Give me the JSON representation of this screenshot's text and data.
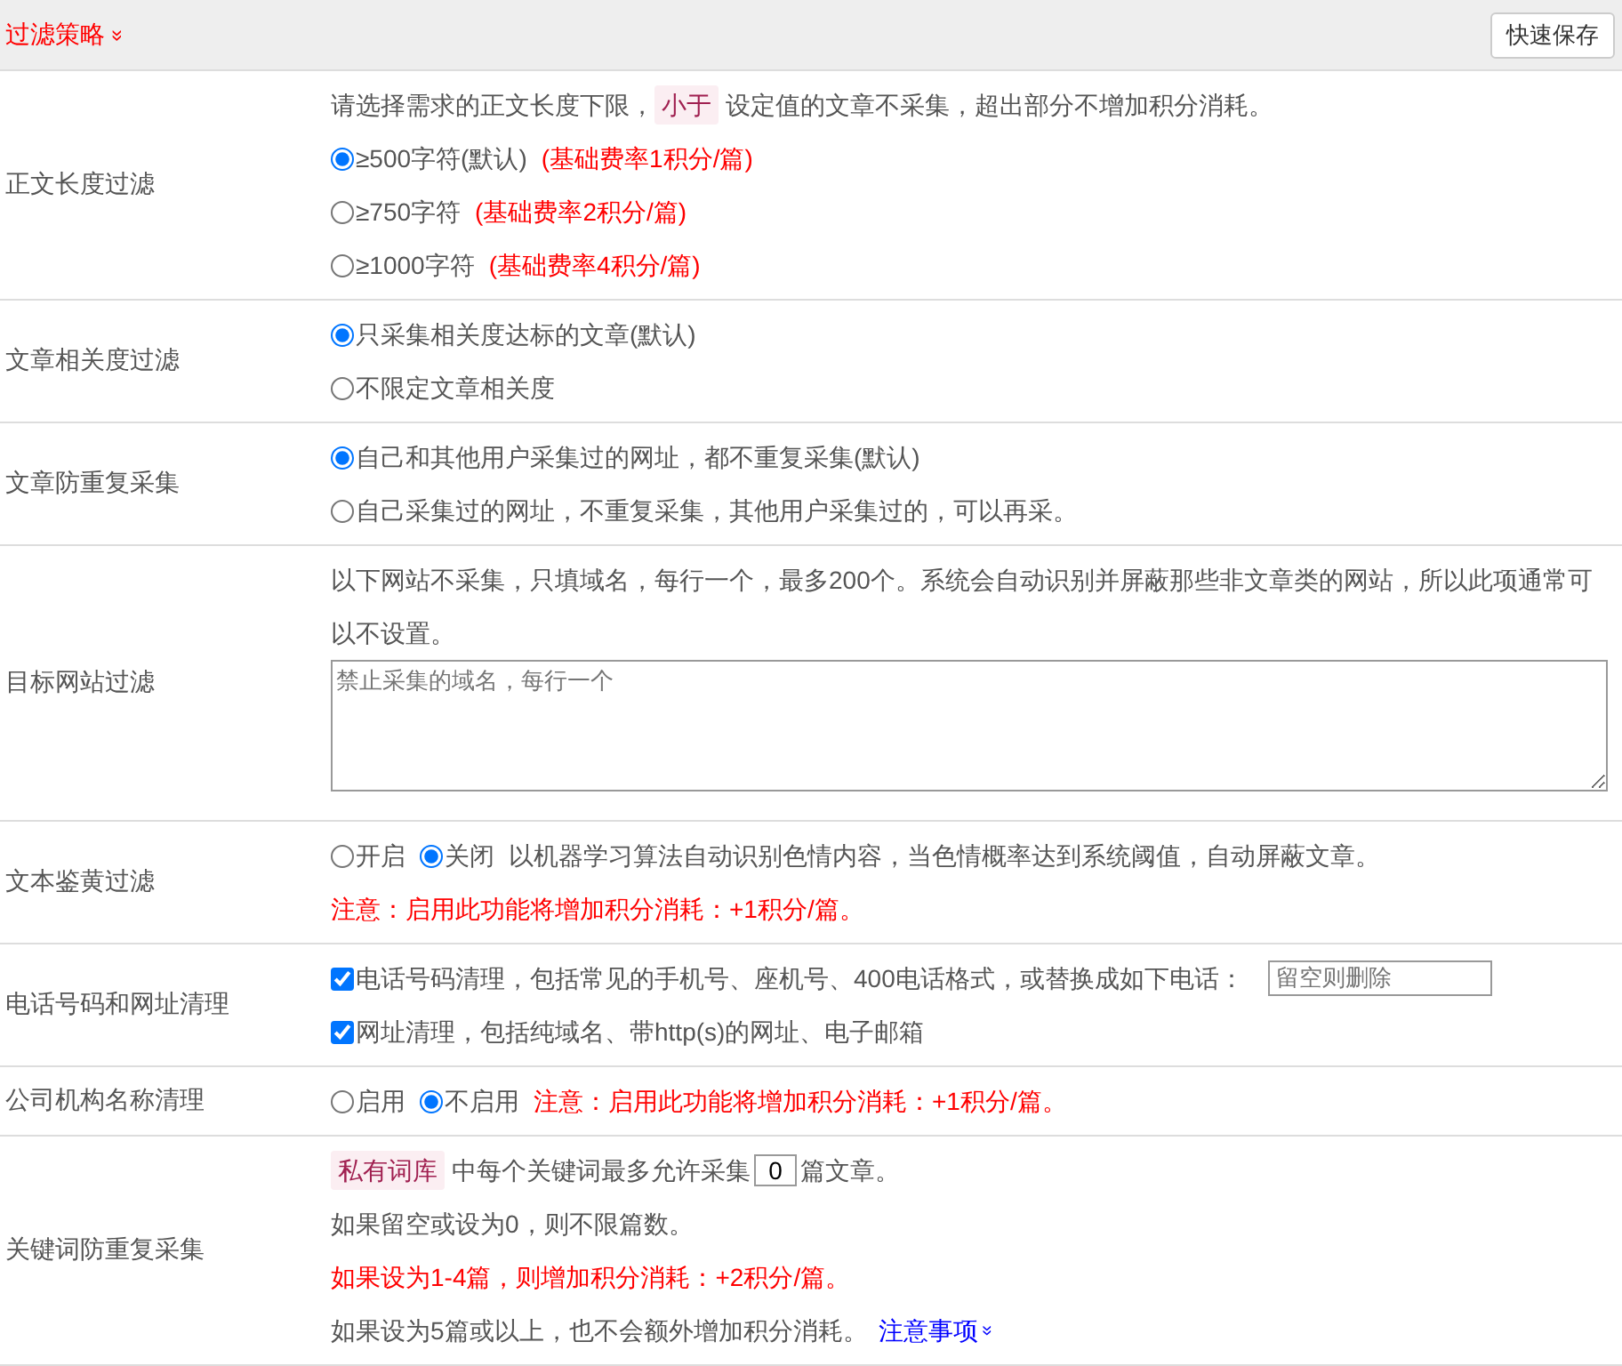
{
  "header": {
    "title": "过滤策略",
    "toggle": "»",
    "button": "快速保存"
  },
  "rows": [
    {
      "label": "正文长度过滤",
      "lines": [
        [
          {
            "kind": "text",
            "text": "请选择需求的正文长度下限，"
          },
          {
            "kind": "tag",
            "text": "小于"
          },
          {
            "kind": "text",
            "text": "设定值的文章不采集，超出部分不增加积分消耗。"
          }
        ],
        [
          {
            "kind": "radio",
            "label": "≥500字符(默认)",
            "selected": true
          },
          {
            "kind": "red",
            "text": "(基础费率1积分/篇)"
          }
        ],
        [
          {
            "kind": "radio",
            "label": "≥750字符",
            "selected": false
          },
          {
            "kind": "red",
            "text": "(基础费率2积分/篇)"
          }
        ],
        [
          {
            "kind": "radio",
            "label": "≥1000字符",
            "selected": false
          },
          {
            "kind": "red",
            "text": "(基础费率4积分/篇)"
          }
        ]
      ]
    },
    {
      "label": "文章相关度过滤",
      "lines": [
        [
          {
            "kind": "radio",
            "label": "只采集相关度达标的文章(默认)",
            "selected": true
          }
        ],
        [
          {
            "kind": "radio",
            "label": "不限定文章相关度",
            "selected": false
          }
        ]
      ]
    },
    {
      "label": "文章防重复采集",
      "lines": [
        [
          {
            "kind": "radio",
            "label": "自己和其他用户采集过的网址，都不重复采集(默认)",
            "selected": true
          }
        ],
        [
          {
            "kind": "radio",
            "label": "自己采集过的网址，不重复采集，其他用户采集过的，可以再采。",
            "selected": false
          }
        ]
      ]
    },
    {
      "label": "目标网站过滤",
      "lines": [
        [
          {
            "kind": "text",
            "text": "以下网站不采集，只填域名，每行一个，最多200个。系统会自动识别并屏蔽那些非文章类的网站，所以此项通常可以不设置。"
          }
        ],
        [
          {
            "kind": "textarea",
            "placeholder": "禁止采集的域名，每行一个"
          }
        ]
      ]
    },
    {
      "label": "文本鉴黄过滤",
      "lines": [
        [
          {
            "kind": "radio",
            "label": "开启",
            "selected": false
          },
          {
            "kind": "radio",
            "label": "关闭",
            "selected": true
          },
          {
            "kind": "text",
            "text": "以机器学习算法自动识别色情内容，当色情概率达到系统阈值，自动屏蔽文章。"
          }
        ],
        [
          {
            "kind": "red",
            "text": "注意：启用此功能将增加积分消耗：+1积分/篇。"
          }
        ]
      ]
    },
    {
      "label": "电话号码和网址清理",
      "lines": [
        [
          {
            "kind": "checkbox",
            "label": "电话号码清理，包括常见的手机号、座机号、400电话格式，或替换成如下电话：",
            "checked": true
          },
          {
            "kind": "input",
            "placeholder": "留空则删除"
          }
        ],
        [
          {
            "kind": "checkbox",
            "label": "网址清理，包括纯域名、带http(s)的网址、电子邮箱",
            "checked": true
          }
        ]
      ]
    },
    {
      "label": "公司机构名称清理",
      "lines": [
        [
          {
            "kind": "radio",
            "label": "启用",
            "selected": false
          },
          {
            "kind": "radio",
            "label": "不启用",
            "selected": true
          },
          {
            "kind": "red",
            "text": "注意：启用此功能将增加积分消耗：+1积分/篇。"
          }
        ]
      ]
    },
    {
      "label": "关键词防重复采集",
      "lines": [
        [
          {
            "kind": "tag",
            "text": "私有词库"
          },
          {
            "kind": "text",
            "text": "中每个关键词最多允许采集"
          },
          {
            "kind": "number",
            "value": "0"
          },
          {
            "kind": "text",
            "text": "篇文章。"
          }
        ],
        [
          {
            "kind": "text",
            "text": "如果留空或设为0，则不限篇数。"
          }
        ],
        [
          {
            "kind": "red",
            "text": "如果设为1-4篇，则增加积分消耗：+2积分/篇。"
          }
        ],
        [
          {
            "kind": "text",
            "text": "如果设为5篇或以上，也不会额外增加积分消耗。"
          },
          {
            "kind": "link",
            "text": "注意事项",
            "toggle": "»"
          }
        ]
      ]
    }
  ]
}
